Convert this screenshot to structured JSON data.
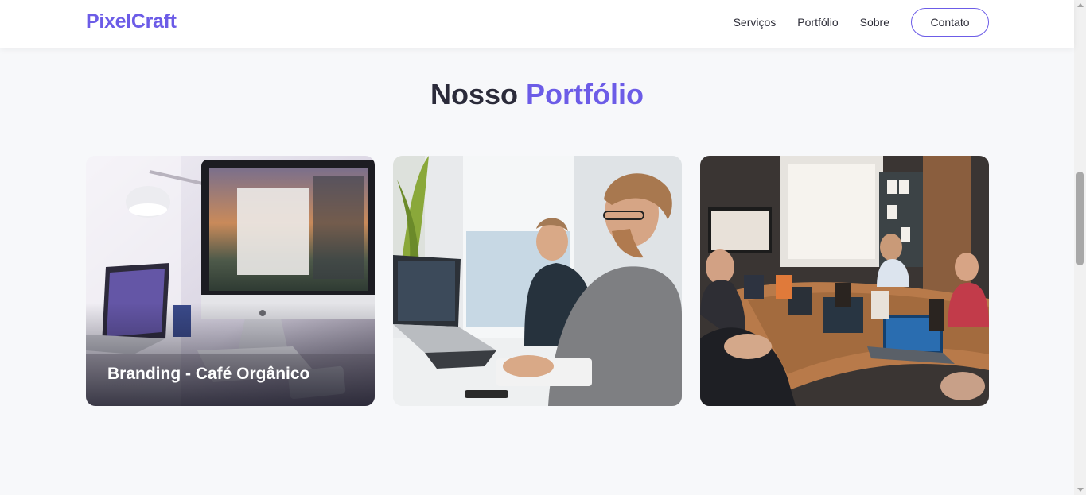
{
  "header": {
    "logo": "PixelCraft",
    "nav": [
      "Serviços",
      "Portfólio",
      "Sobre"
    ],
    "cta": "Contato"
  },
  "section": {
    "title_prefix": "Nosso",
    "title_accent": "Portfólio"
  },
  "portfolio": {
    "items": [
      {
        "caption": "Branding - Café Orgânico",
        "image": "imac-desk-photo"
      },
      {
        "caption": "",
        "image": "developers-at-laptops-photo"
      },
      {
        "caption": "",
        "image": "meeting-room-photo"
      }
    ]
  },
  "colors": {
    "accent": "#6c5ce7",
    "text": "#2b2b3a",
    "background": "#f7f8fa"
  }
}
